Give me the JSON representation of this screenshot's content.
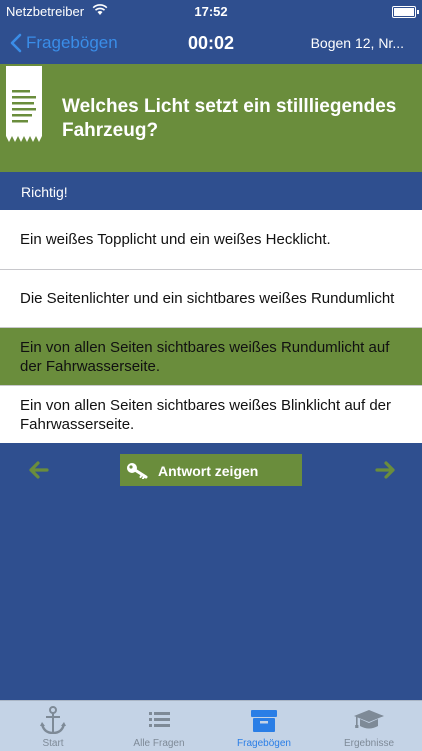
{
  "status_bar": {
    "carrier": "Netzbetreiber",
    "time": "17:52"
  },
  "nav": {
    "back_label": "Fragebögen",
    "timer": "00:02",
    "sheet": "Bogen 12, Nr..."
  },
  "question": {
    "text": "Welches Licht setzt ein stillliegendes Fahrzeug?"
  },
  "feedback": {
    "text": "Richtig!"
  },
  "answers": [
    {
      "text": "Ein weißes Topplicht und ein weißes Hecklicht."
    },
    {
      "text": "Die Seitenlichter und ein sichtbares weißes Rundumlicht"
    },
    {
      "text": "Ein von allen Seiten sichtbares weißes Rundumlicht auf der Fahrwasserseite.",
      "correct": true
    },
    {
      "text": "Ein von allen Seiten sichtbares weißes Blinklicht auf der Fahrwasserseite."
    }
  ],
  "controls": {
    "show_answer_label": "Antwort zeigen"
  },
  "tabs": [
    {
      "label": "Start",
      "icon": "anchor-icon"
    },
    {
      "label": "Alle Fragen",
      "icon": "list-icon"
    },
    {
      "label": "Fragebögen",
      "icon": "box-icon",
      "active": true
    },
    {
      "label": "Ergebnisse",
      "icon": "graduation-cap-icon"
    }
  ],
  "colors": {
    "primary_blue": "#2f4f8f",
    "green": "#6a8d3c",
    "tab_bar": "#c4d3e6",
    "active_tab": "#2a7ee6",
    "back_link": "#3a8de8"
  }
}
